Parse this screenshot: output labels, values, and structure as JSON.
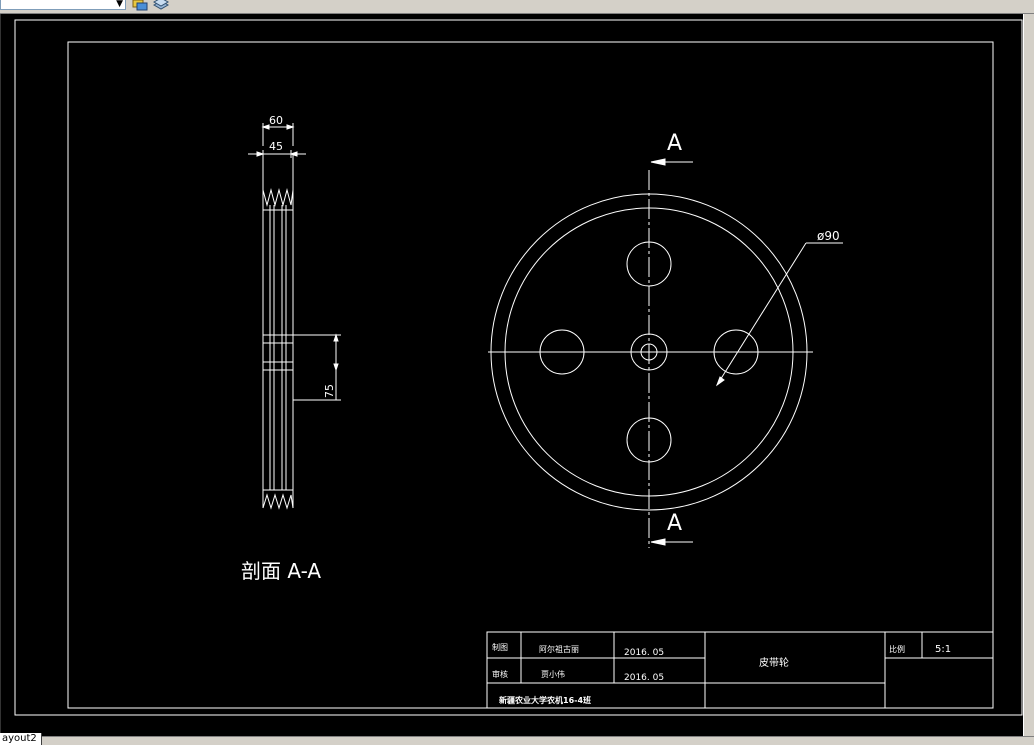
{
  "toolbar": {
    "layer_combo_value": "",
    "icons": [
      "layer-states-icon",
      "layer-previous-icon"
    ]
  },
  "drawing": {
    "section_view": {
      "dim_overall_width": "60",
      "dim_groove_width": "45",
      "dim_hub_length": "75",
      "section_label": "剖面 A-A"
    },
    "front_view": {
      "section_marker_top": "A",
      "section_marker_bottom": "A",
      "dim_diameter": "ø90"
    },
    "title_block": {
      "drawn_label": "制图",
      "drawn_name": "阿尔祖古丽",
      "drawn_date": "2016. 05",
      "checked_label": "审核",
      "checked_name": "贾小伟",
      "checked_date": "2016. 05",
      "part_name": "皮带轮",
      "scale_label": "比例",
      "scale_value": "5:1",
      "school": "新疆农业大学农机16-4班"
    }
  },
  "status": {
    "layout_tab": "ayout2"
  },
  "colors": {
    "background": "#000000",
    "lines": "#ffffff",
    "ui_face": "#d4d0c8"
  }
}
